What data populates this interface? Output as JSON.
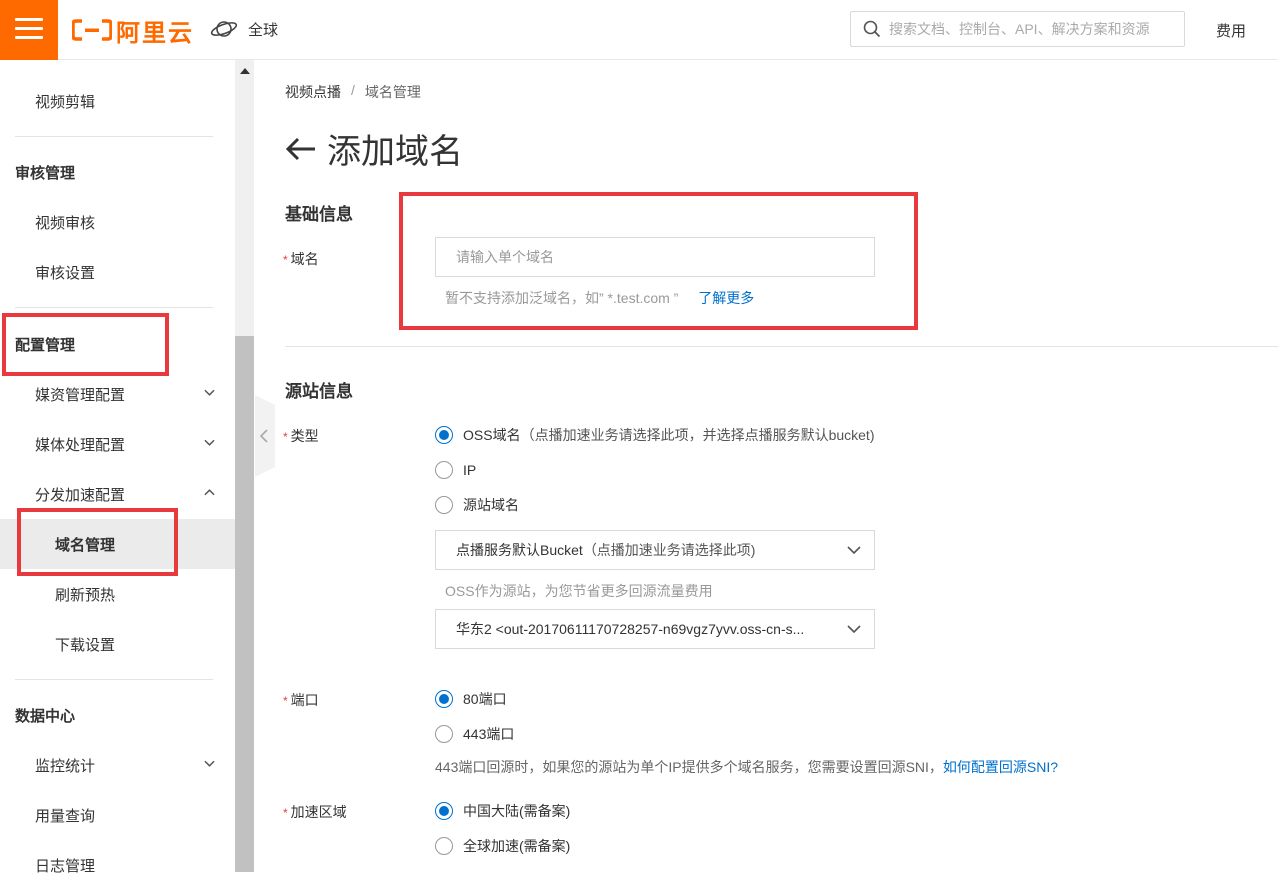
{
  "topbar": {
    "logo_text": "阿里云",
    "region": "全球",
    "search_placeholder": "搜索文档、控制台、API、解决方案和资源",
    "fee": "费用"
  },
  "sidebar": {
    "items": [
      {
        "label": "视频剪辑"
      },
      {
        "label": "审核管理"
      },
      {
        "label": "视频审核"
      },
      {
        "label": "审核设置"
      },
      {
        "label": "配置管理"
      },
      {
        "label": "媒资管理配置"
      },
      {
        "label": "媒体处理配置"
      },
      {
        "label": "分发加速配置"
      },
      {
        "label": "域名管理"
      },
      {
        "label": "刷新预热"
      },
      {
        "label": "下载设置"
      },
      {
        "label": "数据中心"
      },
      {
        "label": "监控统计"
      },
      {
        "label": "用量查询"
      },
      {
        "label": "日志管理"
      }
    ]
  },
  "breadcrumb": {
    "parent": "视频点播",
    "separator": "/",
    "current": "域名管理"
  },
  "page": {
    "title": "添加域名"
  },
  "basic": {
    "section_title": "基础信息",
    "domain_label": "域名",
    "domain_placeholder": "请输入单个域名",
    "domain_hint": "暂不支持添加泛域名，如” *.test.com ”",
    "learn_more": "了解更多"
  },
  "origin": {
    "section_title": "源站信息",
    "type_label": "类型",
    "type_options": [
      {
        "label": "OSS域名",
        "note": "（点播加速业务请选择此项，并选择点播服务默认bucket)"
      },
      {
        "label": "IP",
        "note": ""
      },
      {
        "label": "源站域名",
        "note": ""
      }
    ],
    "bucket_select": {
      "value": "点播服务默认Bucket",
      "note": "（点播加速业务请选择此项)"
    },
    "bucket_hint": "OSS作为源站，为您节省更多回源流量费用",
    "oss_select": "华东2 <out-20170611170728257-n69vgz7yvv.oss-cn-s...",
    "port_label": "端口",
    "port_options": [
      {
        "label": "80端口"
      },
      {
        "label": "443端口"
      }
    ],
    "port_hint": "443端口回源时，如果您的源站为单个IP提供多个域名服务，您需要设置回源SNI，",
    "port_hint_link": "如何配置回源SNI?",
    "region_label": "加速区域",
    "region_options": [
      {
        "label": "中国大陆(需备案)"
      },
      {
        "label": "全球加速(需备案)"
      }
    ]
  },
  "colors": {
    "brand": "#ff6a00",
    "link": "#0070cc",
    "highlight_box": "#e83a3e"
  }
}
